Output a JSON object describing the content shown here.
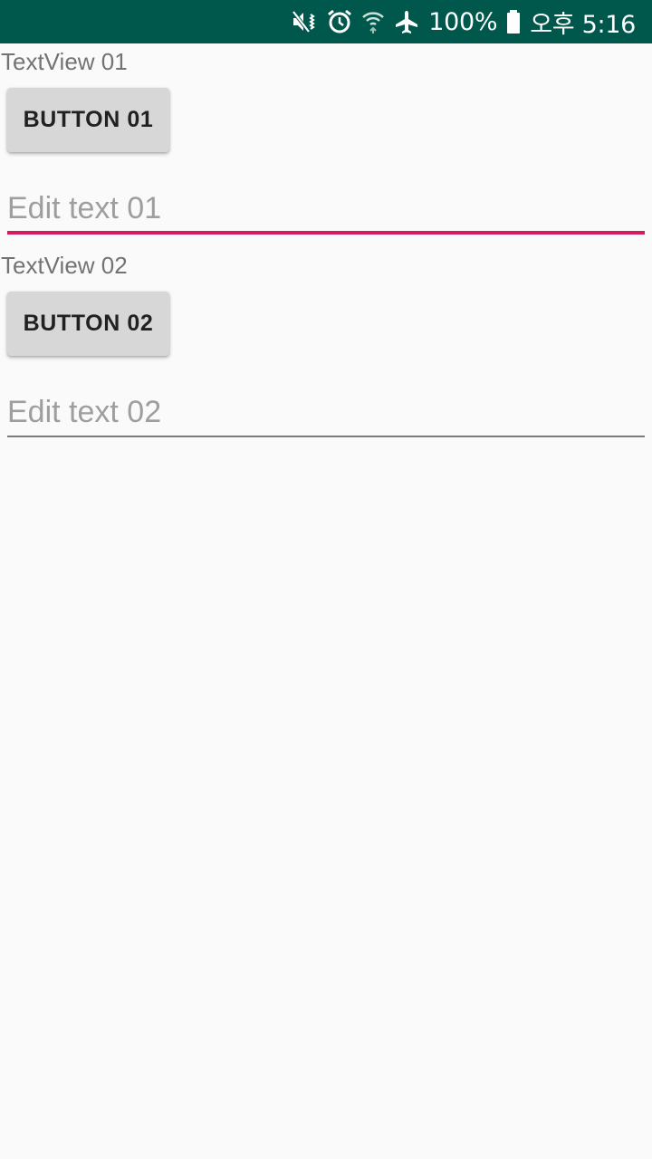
{
  "status_bar": {
    "background": "#00574b",
    "icons": [
      "mute-vibrate-icon",
      "alarm-icon",
      "wifi-icon",
      "airplane-mode-icon"
    ],
    "battery_text": "100%",
    "battery_icon": "battery-full-icon",
    "time": "오후 5:16"
  },
  "main": {
    "textview_01": "TextView 01",
    "button_01": "BUTTON 01",
    "edit_01": {
      "placeholder": "Edit text 01",
      "value": "",
      "focused": true
    },
    "textview_02": "TextView 02",
    "button_02": "BUTTON 02",
    "edit_02": {
      "placeholder": "Edit text 02",
      "value": "",
      "focused": false
    }
  },
  "colors": {
    "accent": "#d81b60",
    "primary_dark": "#00574b",
    "background": "#fafafa"
  }
}
